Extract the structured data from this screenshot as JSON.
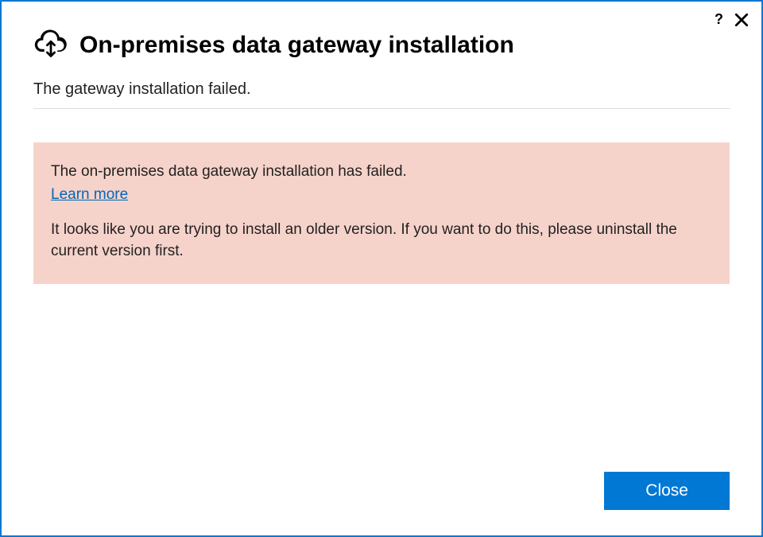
{
  "titlebar": {
    "help_label": "?",
    "close_label": "Close window"
  },
  "header": {
    "title": "On-premises data gateway installation"
  },
  "content": {
    "status": "The gateway installation failed.",
    "error": {
      "title": "The on-premises data gateway installation has failed.",
      "learn_more_label": "Learn more",
      "detail": "It looks like you are trying to install an older version. If you want to do this, please uninstall the current version first."
    }
  },
  "footer": {
    "close_label": "Close"
  },
  "colors": {
    "accent": "#0078d4",
    "error_bg": "#f6d3ca",
    "link": "#0067b8"
  }
}
